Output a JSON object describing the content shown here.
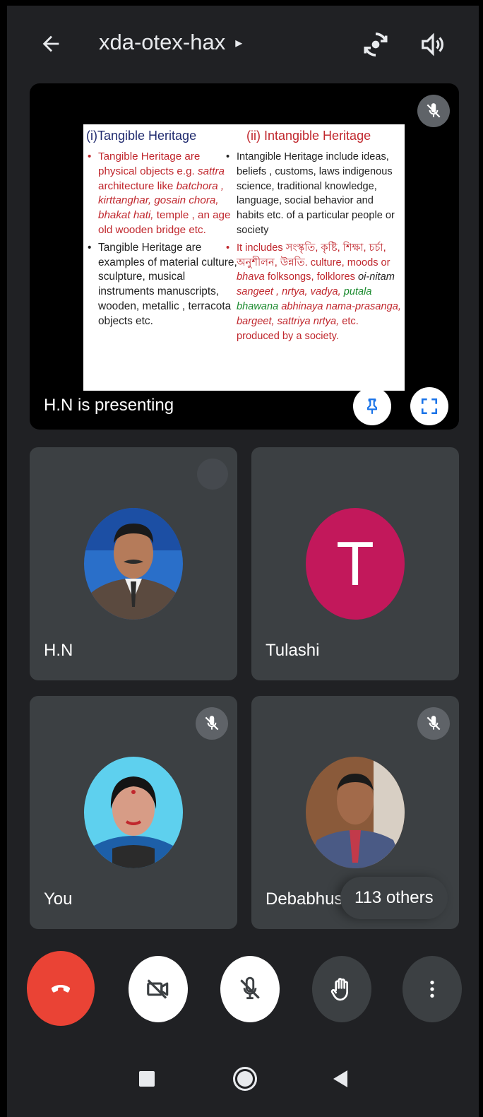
{
  "header": {
    "meeting_code": "xda-otex-hax",
    "caret": "▸",
    "icons": [
      "back-arrow-icon",
      "switch-camera-icon",
      "speaker-icon"
    ]
  },
  "presentation": {
    "status_label": "H.N is presenting",
    "slide": {
      "left_heading": "(i)Tangible Heritage",
      "right_heading": "(ii)  Intangible Heritage",
      "left_bullets": [
        {
          "segments": [
            {
              "text": "Tangible Heritage are physical objects  e.g. ",
              "style": "red"
            },
            {
              "text": "sattra",
              "style": "red ital"
            },
            {
              "text": " architecture like ",
              "style": "red"
            },
            {
              "text": "batchora , kirttanghar, gosain chora,  bhakat hati,",
              "style": "red ital"
            },
            {
              "text": "  temple , an age old wooden bridge etc.",
              "style": "red"
            }
          ]
        },
        {
          "segments": [
            {
              "text": "Tangible Heritage are examples of material culture, sculpture, musical instruments manuscripts, wooden, metallic , terracota objects etc.",
              "style": ""
            }
          ]
        }
      ],
      "right_bullets": [
        {
          "segments": [
            {
              "text": "Intangible  Heritage include ideas, beliefs , customs, laws indigenous science, traditional knowledge, language,  social behavior and habits  etc. of a particular people or society",
              "style": ""
            }
          ]
        },
        {
          "segments": [
            {
              "text": "It includes সংস্কৃতি, কৃষ্টি, শিক্ষা, চর্চা, অনুশীলন, উন্নতি. culture, moods or ",
              "style": "red"
            },
            {
              "text": "bhava",
              "style": "red ital"
            },
            {
              "text": " folksongs, folklores  ",
              "style": "red"
            },
            {
              "text": "oi-nitam",
              "style": "ital"
            },
            {
              "text": " ",
              "style": ""
            },
            {
              "text": "sangeet ,",
              "style": "red ital"
            },
            {
              "text": " ",
              "style": ""
            },
            {
              "text": "nrtya, vadya,",
              "style": "red ital"
            },
            {
              "text": " ",
              "style": ""
            },
            {
              "text": "putala bhawana",
              "style": "green ital"
            },
            {
              "text": " ",
              "style": ""
            },
            {
              "text": "abhinaya  nama-prasanga, bargeet, sattriya nrtya,",
              "style": "red ital"
            },
            {
              "text": " etc. produced by a society.",
              "style": "red"
            }
          ]
        }
      ]
    }
  },
  "participants": [
    {
      "name": "H.N",
      "avatar": "photo",
      "muted": false,
      "show_more": true
    },
    {
      "name": "Tulashi",
      "avatar_letter": "T",
      "avatar_color": "#c2185b",
      "muted": false
    },
    {
      "name": "You",
      "avatar": "photo",
      "muted": true
    },
    {
      "name": "Debabhusan",
      "avatar": "photo",
      "muted": true,
      "others_chip": "113 others"
    }
  ],
  "controls": {
    "end_call_color": "#ea4335",
    "buttons": [
      "end-call",
      "camera-off",
      "mic-off",
      "raise-hand",
      "more-options"
    ]
  },
  "colors": {
    "background": "#202124",
    "tile": "#3c4043",
    "accent_red": "#ea4335"
  }
}
